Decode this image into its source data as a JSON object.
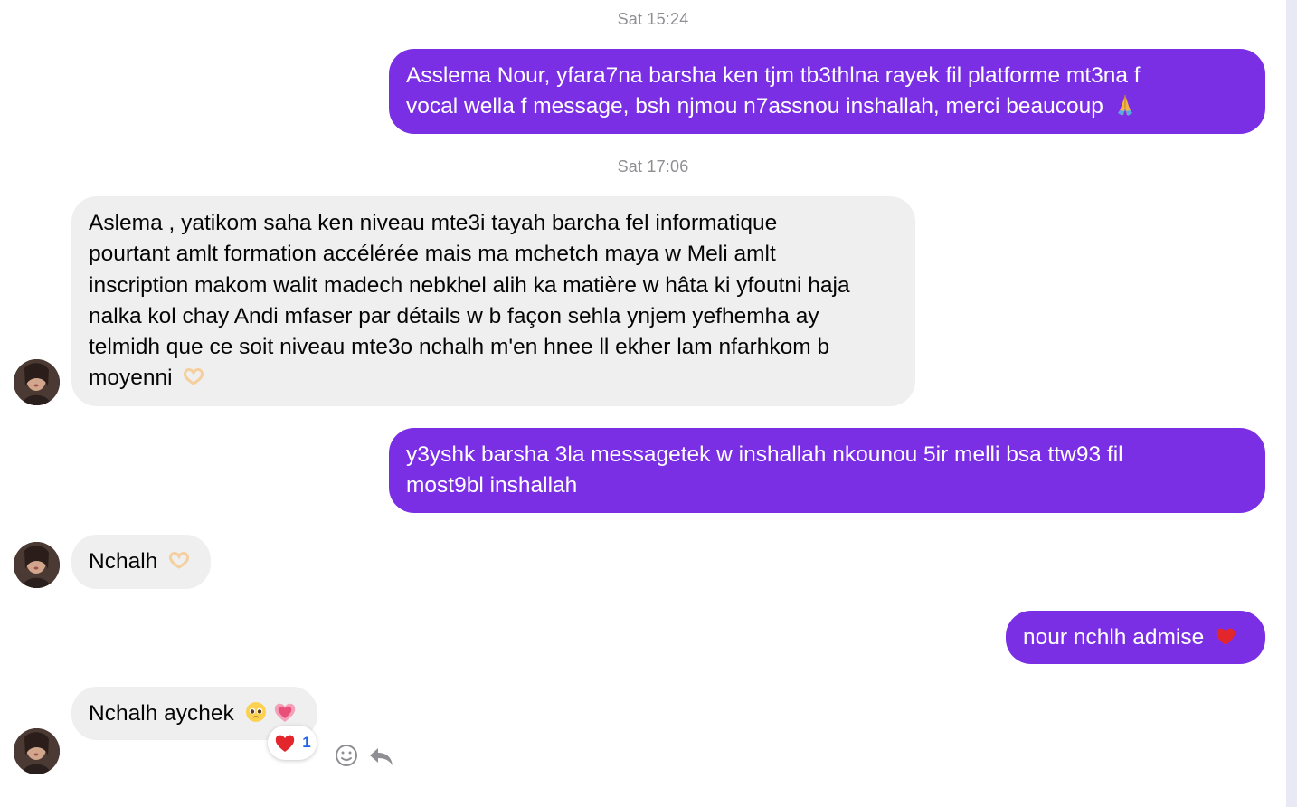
{
  "colors": {
    "outgoing_bubble": "#7b2fe5",
    "incoming_bubble": "#efefef",
    "timestamp_text": "#8e8e93",
    "reaction_count": "#1d63e8"
  },
  "timestamps": [
    "Sat 15:24",
    "Sat 17:06"
  ],
  "messages": [
    {
      "direction": "outgoing",
      "lines": [
        "Asslema Nour, yfara7na barsha ken tjm tb3thlna rayek fil platforme mt3na f",
        "vocal wella f message, bsh njmou n7assnou inshallah, merci beaucoup"
      ],
      "emoji": "folded-hands-icon"
    },
    {
      "direction": "incoming",
      "lines": [
        "Aslema , yatikom saha ken niveau mte3i tayah barcha fel informatique",
        "pourtant amlt formation accélérée mais ma mchetch maya w Meli amlt",
        "inscription makom walit madech nebkhel alih ka matière w hâta ki yfoutni haja",
        "nalka kol chay Andi mfaser par détails w b façon sehla ynjem yefhemha ay",
        "telmidh que ce soit niveau mte3o nchalh m'en hnee ll ekher lam nfarhkom b",
        "moyenni"
      ],
      "emoji": "heart-hands-icon"
    },
    {
      "direction": "outgoing",
      "lines": [
        "y3yshk barsha 3la messagetek w inshallah nkounou 5ir melli bsa ttw93 fil",
        "most9bl inshallah"
      ]
    },
    {
      "direction": "incoming",
      "lines": [
        "Nchalh"
      ],
      "emoji": "heart-hands-icon"
    },
    {
      "direction": "outgoing",
      "lines": [
        "nour nchlh admise"
      ],
      "emoji": "red-heart-icon"
    },
    {
      "direction": "incoming",
      "lines": [
        "Nchalh aychek"
      ],
      "emojis": [
        "pleading-face-icon",
        "growing-heart-icon"
      ],
      "reaction": {
        "emoji": "red-heart-icon",
        "count": "1"
      }
    }
  ],
  "actions": {
    "react_icon": "smiley-icon",
    "reply_icon": "reply-arrow-icon"
  }
}
